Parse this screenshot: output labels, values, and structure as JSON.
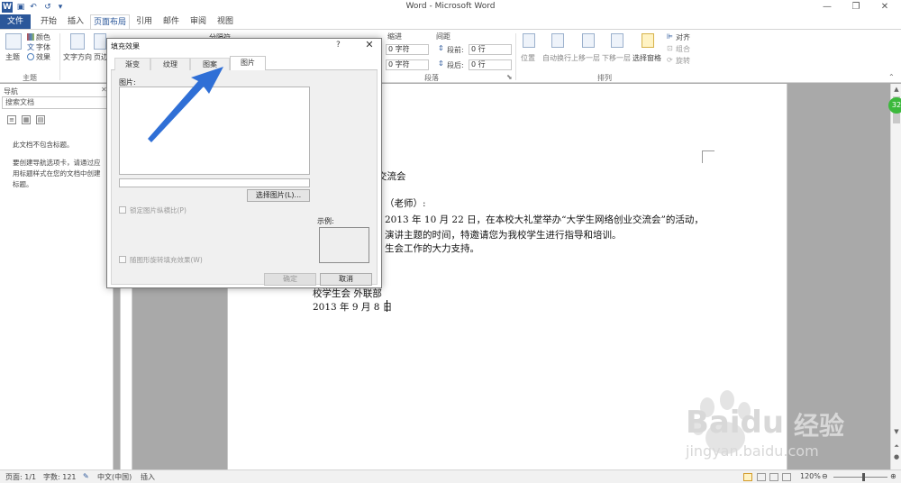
{
  "window": {
    "title": "Word - Microsoft Word",
    "minimize_icon": "minimize-icon",
    "restore_icon": "restore-icon",
    "close_icon": "close-icon"
  },
  "quick_access": [
    "word-logo-icon",
    "save-icon",
    "undo-icon",
    "redo-icon",
    "customize-icon"
  ],
  "tabs": [
    {
      "label": "文件"
    },
    {
      "label": "开始"
    },
    {
      "label": "插入"
    },
    {
      "label": "页面布局"
    },
    {
      "label": "引用"
    },
    {
      "label": "邮件"
    },
    {
      "label": "审阅"
    },
    {
      "label": "视图"
    }
  ],
  "ribbon": {
    "theme_group": {
      "themes_label": "主题",
      "colors_label": "颜色",
      "fonts_label": "字体",
      "effects_label": "效果",
      "group_name": "主题"
    },
    "page_setup": {
      "text_direction_label": "文字方向",
      "margins_label": "页边",
      "breaks_label": "分隔符"
    },
    "indent": {
      "header": "缩进",
      "left_value": "0 字符",
      "right_value": "0 字符"
    },
    "spacing": {
      "header": "间距",
      "before_label": "段前:",
      "before_value": "0 行",
      "after_label": "段后:",
      "after_value": "0 行"
    },
    "paragraph_group": "段落",
    "arrange": {
      "position": "位置",
      "wrap_text": "自动换行",
      "bring_forward": "上移一层",
      "send_backward": "下移一层",
      "selection_pane": "选择窗格",
      "align": "对齐",
      "group": "组合",
      "rotate": "旋转",
      "group_name": "排列"
    }
  },
  "nav_pane": {
    "header": "导航",
    "search_placeholder": "搜索文档",
    "message_line1": "此文档不包含标题。",
    "message_line2": "要创建导航选项卡，请通过应",
    "message_line3": "用标题样式在您的文档中创建",
    "message_line4": "标题。"
  },
  "document": {
    "line1": "交流会",
    "line2": "（老师）:",
    "line3": "2013 年 10 月 22 日，在本校大礼堂举办“大学生网络创业交流会”的活动，",
    "line4": "演讲主题的时间，特邀请您为我校学生进行指导和培训。",
    "line5": "生会工作的大力支持。",
    "line6": "校学生会  外联部",
    "line7": "2013 年 9 月 8 日"
  },
  "dialog": {
    "title": "填充效果",
    "help": "?",
    "close": "✕",
    "tabs": [
      "渐变",
      "纹理",
      "图案",
      "图片"
    ],
    "active_tab": "图片",
    "picture_label": "图片:",
    "select_button": "选择图片(L)...",
    "lock_aspect_label": "锁定图片纵横比(P)",
    "rotate_with_shape_label": "随图形旋转填充效果(W)",
    "sample_label": "示例:",
    "ok_button": "确定",
    "cancel_button": "取消"
  },
  "status_bar": {
    "page": "页面: 1/1",
    "words": "字数: 121",
    "language": "中文(中国)",
    "mode": "插入",
    "zoom": "120%"
  },
  "badge": "32",
  "watermark": {
    "brand": "Baidu",
    "brand_cn": "经验",
    "url": "jingyan.baidu.com"
  },
  "arrow_color": "#2f6fd6",
  "accent_color": "#2b579a"
}
